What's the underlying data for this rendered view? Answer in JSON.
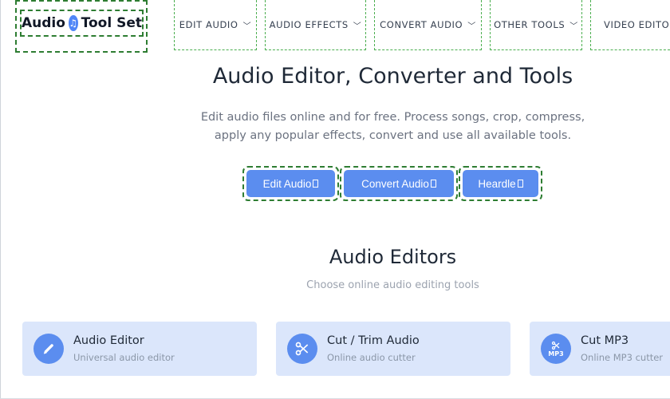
{
  "logo": {
    "text_left": "Audio",
    "text_right": "Tool Set",
    "icon": "music-note-icon"
  },
  "nav": [
    {
      "label": "EDIT AUDIO"
    },
    {
      "label": "AUDIO EFFECTS"
    },
    {
      "label": "CONVERT AUDIO"
    },
    {
      "label": "OTHER TOOLS"
    },
    {
      "label": "VIDEO EDITOR"
    }
  ],
  "hero": {
    "title": "Audio Editor, Converter and Tools",
    "description": "Edit audio files online and for free. Process songs, crop, compress, apply any popular effects, convert and use all available tools."
  },
  "buttons": [
    {
      "label": "Edit Audio"
    },
    {
      "label": "Convert Audio"
    },
    {
      "label": "Heardle"
    }
  ],
  "section": {
    "title": "Audio Editors",
    "subtitle": "Choose online audio editing tools"
  },
  "cards": [
    {
      "title": "Audio Editor",
      "description": "Universal audio editor",
      "icon": "pencil-icon"
    },
    {
      "title": "Cut / Trim Audio",
      "description": "Online audio cutter",
      "icon": "scissors-icon"
    },
    {
      "title": "Cut MP3",
      "description": "Online MP3 cutter",
      "icon": "scissors-mp3-icon",
      "badge": "MP3"
    }
  ],
  "colors": {
    "accent": "#5b8def",
    "card_bg": "#dbe6fb",
    "outline": "#2e7d32"
  }
}
